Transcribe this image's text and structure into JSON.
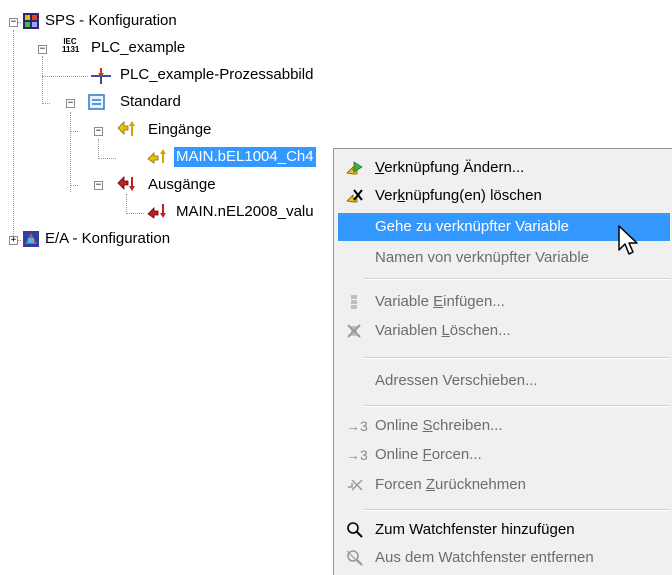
{
  "tree": {
    "root_label": "SPS - Konfiguration",
    "plc_label": "PLC_example",
    "plc_badge": "IEC 1131",
    "prozessabbild_label": "PLC_example-Prozessabbild",
    "standard_label": "Standard",
    "eingaenge_label": "Eingänge",
    "input_var_label": "MAIN.bEL1004_Ch4",
    "ausgaenge_label": "Ausgänge",
    "output_var_label": "MAIN.nEL2008_valu",
    "ea_label": "E/A - Konfiguration",
    "expand_minus": "−",
    "expand_plus": "+"
  },
  "context_menu": {
    "items": [
      {
        "pre": "",
        "key": "V",
        "post": "erknüpfung Ändern...",
        "disabled": false,
        "icon": "link-change-icon"
      },
      {
        "pre": "Ver",
        "key": "k",
        "post": "nüpfung(en) löschen",
        "disabled": false,
        "icon": "link-delete-icon"
      },
      {
        "pre": "Gehe zu verknüpfter Variable",
        "key": "",
        "post": "",
        "disabled": false,
        "highlighted": true
      },
      {
        "pre": "Namen von verknüpfter Variable",
        "key": "",
        "post": "",
        "disabled": true
      },
      {
        "pre": "Variable ",
        "key": "E",
        "post": "infügen...",
        "disabled": true,
        "icon": "variable-insert-icon"
      },
      {
        "pre": "Variablen ",
        "key": "L",
        "post": "öschen...",
        "disabled": true,
        "icon": "variable-delete-icon"
      },
      {
        "pre": "Adressen Verschieben...",
        "key": "",
        "post": "",
        "disabled": true
      },
      {
        "pre": "Online ",
        "key": "S",
        "post": "chreiben...",
        "disabled": true,
        "icon": "online-write-icon",
        "icon_text": "→3"
      },
      {
        "pre": "Online ",
        "key": "F",
        "post": "orcen...",
        "disabled": true,
        "icon": "online-force-icon",
        "icon_text": "→3"
      },
      {
        "pre": "Forcen ",
        "key": "Z",
        "post": "urücknehmen",
        "disabled": true,
        "icon": "force-undo-icon"
      },
      {
        "pre": "Zum Watchfenster hinzufügen",
        "key": "",
        "post": "",
        "disabled": false,
        "icon": "magnifier-icon"
      },
      {
        "pre": "Aus dem Watchfenster entfernen",
        "key": "",
        "post": "",
        "disabled": true,
        "icon": "magnifier-remove-icon"
      }
    ]
  },
  "colors": {
    "selection": "#3399ff",
    "menu_bg": "#f0f0f0",
    "disabled_text": "#6d6d6d"
  }
}
